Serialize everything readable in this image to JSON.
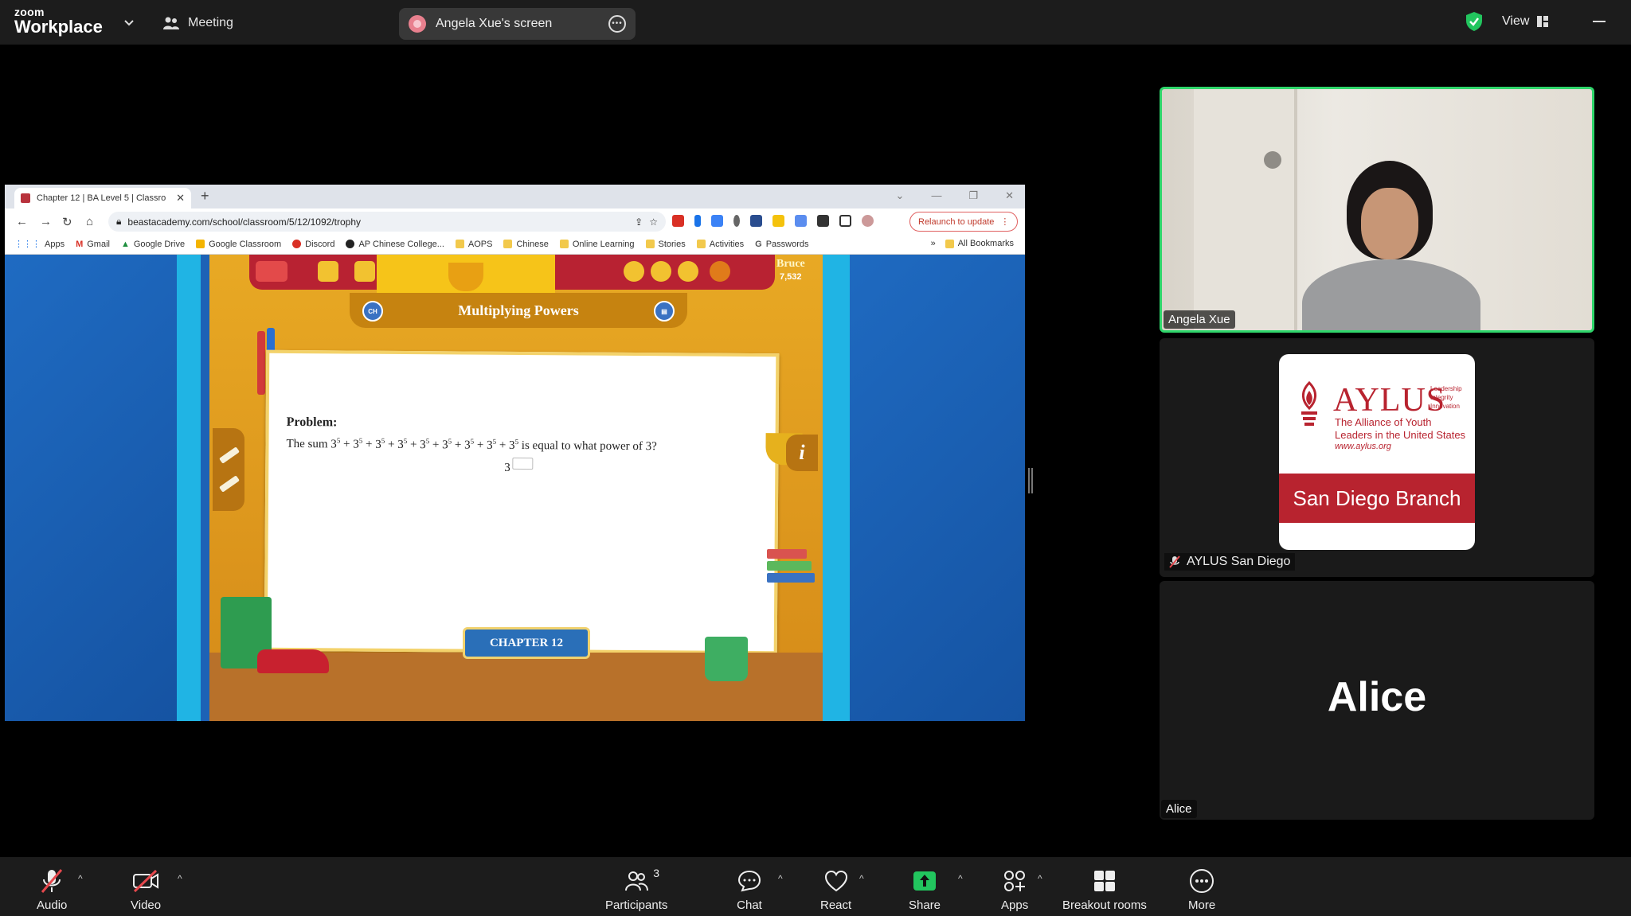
{
  "topbar": {
    "logo_small": "zoom",
    "logo_large": "Workplace",
    "meeting_label": "Meeting",
    "screen_share_label": "Angela Xue's screen",
    "view_label": "View"
  },
  "browser": {
    "tab_title": "Chapter 12 | BA Level 5 | Classro",
    "url": "beastacademy.com/school/classroom/5/12/1092/trophy",
    "relaunch_label": "Relaunch to update",
    "bookmarks": [
      "Apps",
      "Gmail",
      "Google Drive",
      "Google Classroom",
      "Discord",
      "AP Chinese College...",
      "AOPS",
      "Chinese",
      "Online Learning",
      "Stories",
      "Activities",
      "Passwords"
    ],
    "bookmarks_more": "»",
    "all_bookmarks": "All Bookmarks"
  },
  "game": {
    "user_name": "Bruce",
    "user_sub": "7,532",
    "banner_title": "Multiplying Powers",
    "problem_label": "Problem:",
    "problem_prefix": "The sum",
    "problem_suffix": "is equal to what power of 3?",
    "term_base": "3",
    "term_exp": "5",
    "answer_base": "3",
    "chapter_label": "CHAPTER 12"
  },
  "participants": {
    "video_name": "Angela Xue",
    "card_title": "AYLUS",
    "card_tagline": "Leadership Integrity Innovation",
    "card_subtitle": "The Alliance of Youth Leaders in the United States",
    "card_url": "www.aylus.org",
    "card_band": "San Diego Branch",
    "muted_name": "AYLUS San Diego",
    "alice_display": "Alice",
    "alice_tag": "Alice"
  },
  "toolbar": {
    "audio": "Audio",
    "video": "Video",
    "participants": "Participants",
    "participants_count": "3",
    "chat": "Chat",
    "react": "React",
    "share": "Share",
    "apps": "Apps",
    "breakout": "Breakout rooms",
    "more": "More"
  },
  "colors": {
    "active_speaker": "#2fd66b",
    "share_green": "#22c55e",
    "muted_red": "#e5484d",
    "aylus_red": "#b8232f"
  }
}
